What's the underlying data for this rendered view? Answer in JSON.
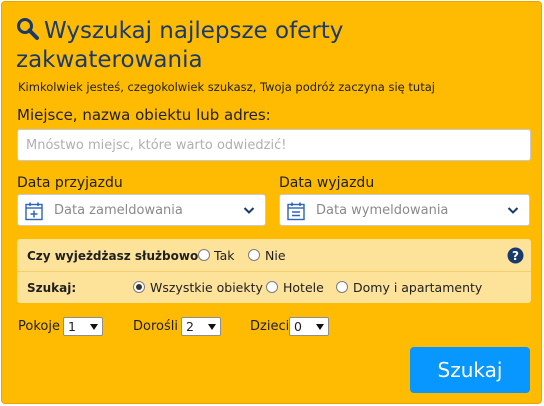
{
  "header": {
    "title_line1": "Wyszukaj najlepsze oferty",
    "title_line2": "zakwaterowania",
    "subtitle": "Kimkolwiek jesteś, czegokolwiek szukasz, Twoja podróż zaczyna się tutaj",
    "icon": "search-icon"
  },
  "destination": {
    "label": "Miejsce, nazwa obiektu lub adres:",
    "value": "",
    "placeholder": "Mnóstwo miejsc, które warto odwiedzić!"
  },
  "checkin": {
    "label": "Data przyjazdu",
    "value": "Data zameldowania",
    "icon": "calendar-icon"
  },
  "checkout": {
    "label": "Data wyjazdu",
    "value": "Data wymeldowania",
    "icon": "calendar-icon"
  },
  "business_trip": {
    "question": "Czy wyjeżdżasz służbowo?",
    "options": [
      "Tak",
      "Nie"
    ],
    "selected": null,
    "help_icon": "help-icon"
  },
  "property_type": {
    "label": "Szukaj:",
    "options": [
      "Wszystkie obiekty",
      "Hotele",
      "Domy i apartamenty"
    ],
    "selected": "Wszystkie obiekty"
  },
  "occupancy": {
    "rooms": {
      "label": "Pokoje",
      "value": "1"
    },
    "adults": {
      "label": "Dorośli",
      "value": "2"
    },
    "children": {
      "label": "Dzieci",
      "value": "0"
    }
  },
  "search_button": {
    "label": "Szukaj"
  },
  "colors": {
    "panel": "#febb02",
    "title": "#1a3a6b",
    "button": "#0896ff",
    "options_bg": "#fde29a"
  }
}
